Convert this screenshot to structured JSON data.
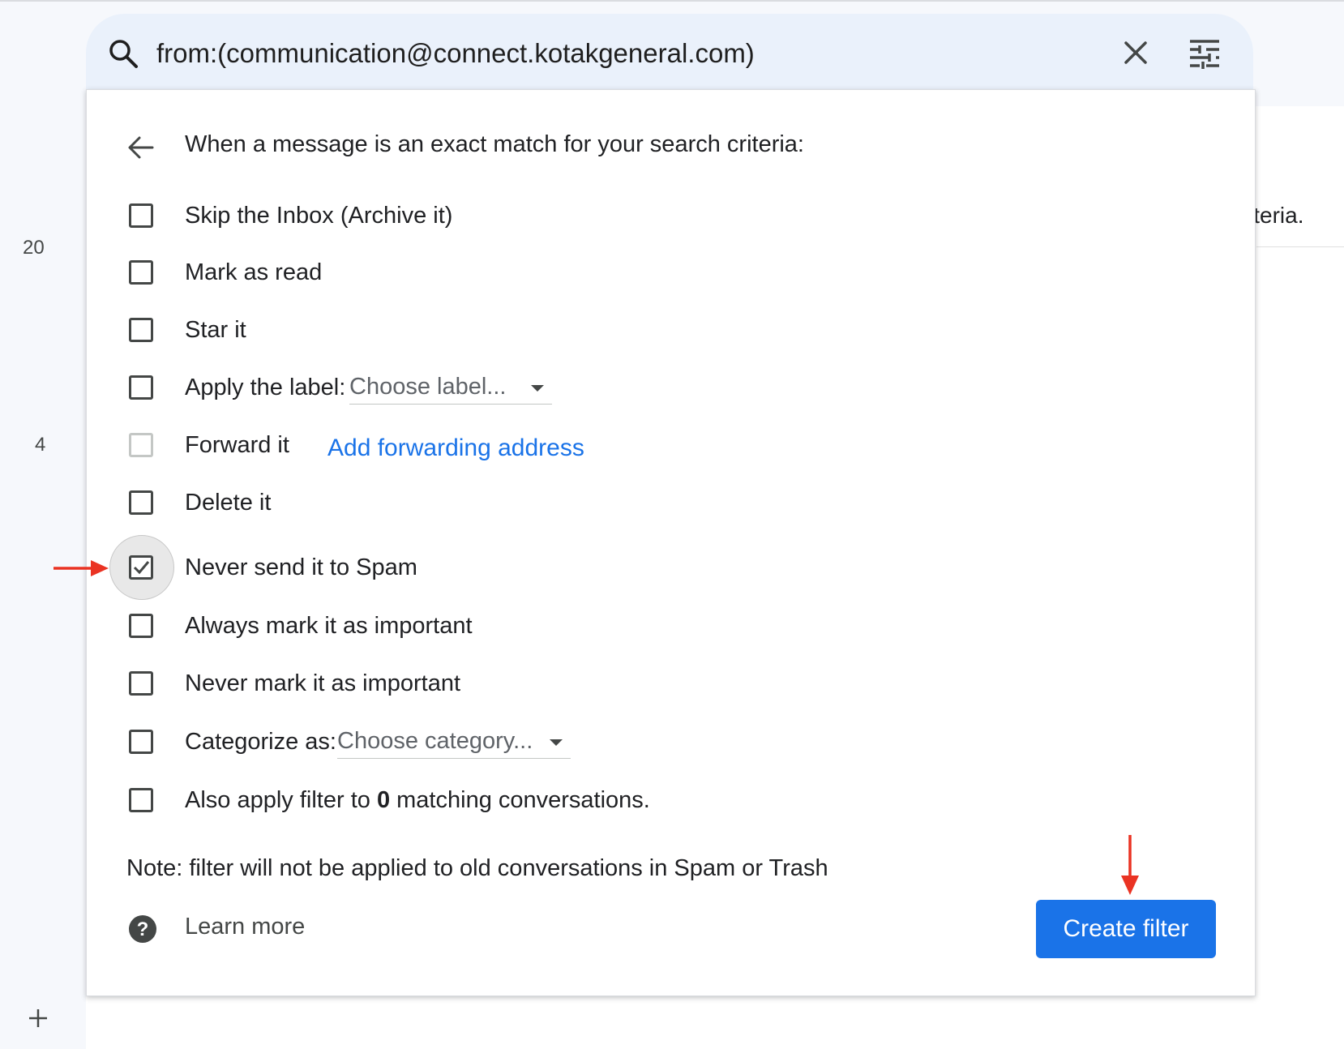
{
  "search": {
    "query": "from:(communication@connect.kotakgeneral.com)"
  },
  "background": {
    "rail_numbers": [
      "20",
      "4"
    ],
    "right_text": "iteria."
  },
  "filter_panel": {
    "heading": "When a message is an exact match for your search criteria:",
    "options": [
      {
        "label": "Skip the Inbox (Archive it)",
        "checked": false
      },
      {
        "label": "Mark as read",
        "checked": false
      },
      {
        "label": "Star it",
        "checked": false
      },
      {
        "label": "Apply the label:",
        "checked": false,
        "select_value": "Choose label..."
      },
      {
        "label": "Forward it",
        "checked": false,
        "link": "Add forwarding address"
      },
      {
        "label": "Delete it",
        "checked": false
      },
      {
        "label": "Never send it to Spam",
        "checked": true
      },
      {
        "label": "Always mark it as important",
        "checked": false
      },
      {
        "label": "Never mark it as important",
        "checked": false
      },
      {
        "label": "Categorize as:",
        "checked": false,
        "select_value": "Choose category..."
      },
      {
        "label_prefix": "Also apply filter to ",
        "label_count": "0",
        "label_suffix": " matching conversations.",
        "checked": false
      }
    ],
    "note": "Note: filter will not be applied to old conversations in Spam or Trash",
    "learn_more": "Learn more",
    "create_button": "Create filter"
  },
  "colors": {
    "accent": "#1a73e8",
    "annotation_arrow": "#ea3323",
    "search_bg": "#eaf1fb"
  }
}
